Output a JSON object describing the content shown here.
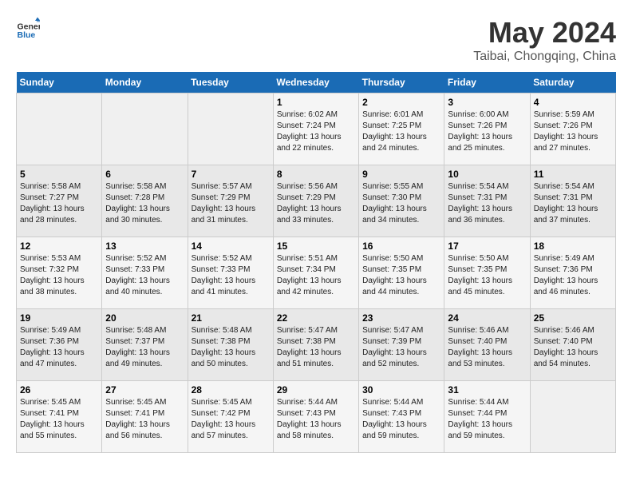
{
  "header": {
    "logo_general": "General",
    "logo_blue": "Blue",
    "title": "May 2024",
    "subtitle": "Taibai, Chongqing, China"
  },
  "days_of_week": [
    "Sunday",
    "Monday",
    "Tuesday",
    "Wednesday",
    "Thursday",
    "Friday",
    "Saturday"
  ],
  "weeks": [
    [
      {
        "day": "",
        "detail": ""
      },
      {
        "day": "",
        "detail": ""
      },
      {
        "day": "",
        "detail": ""
      },
      {
        "day": "1",
        "detail": "Sunrise: 6:02 AM\nSunset: 7:24 PM\nDaylight: 13 hours\nand 22 minutes."
      },
      {
        "day": "2",
        "detail": "Sunrise: 6:01 AM\nSunset: 7:25 PM\nDaylight: 13 hours\nand 24 minutes."
      },
      {
        "day": "3",
        "detail": "Sunrise: 6:00 AM\nSunset: 7:26 PM\nDaylight: 13 hours\nand 25 minutes."
      },
      {
        "day": "4",
        "detail": "Sunrise: 5:59 AM\nSunset: 7:26 PM\nDaylight: 13 hours\nand 27 minutes."
      }
    ],
    [
      {
        "day": "5",
        "detail": "Sunrise: 5:58 AM\nSunset: 7:27 PM\nDaylight: 13 hours\nand 28 minutes."
      },
      {
        "day": "6",
        "detail": "Sunrise: 5:58 AM\nSunset: 7:28 PM\nDaylight: 13 hours\nand 30 minutes."
      },
      {
        "day": "7",
        "detail": "Sunrise: 5:57 AM\nSunset: 7:29 PM\nDaylight: 13 hours\nand 31 minutes."
      },
      {
        "day": "8",
        "detail": "Sunrise: 5:56 AM\nSunset: 7:29 PM\nDaylight: 13 hours\nand 33 minutes."
      },
      {
        "day": "9",
        "detail": "Sunrise: 5:55 AM\nSunset: 7:30 PM\nDaylight: 13 hours\nand 34 minutes."
      },
      {
        "day": "10",
        "detail": "Sunrise: 5:54 AM\nSunset: 7:31 PM\nDaylight: 13 hours\nand 36 minutes."
      },
      {
        "day": "11",
        "detail": "Sunrise: 5:54 AM\nSunset: 7:31 PM\nDaylight: 13 hours\nand 37 minutes."
      }
    ],
    [
      {
        "day": "12",
        "detail": "Sunrise: 5:53 AM\nSunset: 7:32 PM\nDaylight: 13 hours\nand 38 minutes."
      },
      {
        "day": "13",
        "detail": "Sunrise: 5:52 AM\nSunset: 7:33 PM\nDaylight: 13 hours\nand 40 minutes."
      },
      {
        "day": "14",
        "detail": "Sunrise: 5:52 AM\nSunset: 7:33 PM\nDaylight: 13 hours\nand 41 minutes."
      },
      {
        "day": "15",
        "detail": "Sunrise: 5:51 AM\nSunset: 7:34 PM\nDaylight: 13 hours\nand 42 minutes."
      },
      {
        "day": "16",
        "detail": "Sunrise: 5:50 AM\nSunset: 7:35 PM\nDaylight: 13 hours\nand 44 minutes."
      },
      {
        "day": "17",
        "detail": "Sunrise: 5:50 AM\nSunset: 7:35 PM\nDaylight: 13 hours\nand 45 minutes."
      },
      {
        "day": "18",
        "detail": "Sunrise: 5:49 AM\nSunset: 7:36 PM\nDaylight: 13 hours\nand 46 minutes."
      }
    ],
    [
      {
        "day": "19",
        "detail": "Sunrise: 5:49 AM\nSunset: 7:36 PM\nDaylight: 13 hours\nand 47 minutes."
      },
      {
        "day": "20",
        "detail": "Sunrise: 5:48 AM\nSunset: 7:37 PM\nDaylight: 13 hours\nand 49 minutes."
      },
      {
        "day": "21",
        "detail": "Sunrise: 5:48 AM\nSunset: 7:38 PM\nDaylight: 13 hours\nand 50 minutes."
      },
      {
        "day": "22",
        "detail": "Sunrise: 5:47 AM\nSunset: 7:38 PM\nDaylight: 13 hours\nand 51 minutes."
      },
      {
        "day": "23",
        "detail": "Sunrise: 5:47 AM\nSunset: 7:39 PM\nDaylight: 13 hours\nand 52 minutes."
      },
      {
        "day": "24",
        "detail": "Sunrise: 5:46 AM\nSunset: 7:40 PM\nDaylight: 13 hours\nand 53 minutes."
      },
      {
        "day": "25",
        "detail": "Sunrise: 5:46 AM\nSunset: 7:40 PM\nDaylight: 13 hours\nand 54 minutes."
      }
    ],
    [
      {
        "day": "26",
        "detail": "Sunrise: 5:45 AM\nSunset: 7:41 PM\nDaylight: 13 hours\nand 55 minutes."
      },
      {
        "day": "27",
        "detail": "Sunrise: 5:45 AM\nSunset: 7:41 PM\nDaylight: 13 hours\nand 56 minutes."
      },
      {
        "day": "28",
        "detail": "Sunrise: 5:45 AM\nSunset: 7:42 PM\nDaylight: 13 hours\nand 57 minutes."
      },
      {
        "day": "29",
        "detail": "Sunrise: 5:44 AM\nSunset: 7:43 PM\nDaylight: 13 hours\nand 58 minutes."
      },
      {
        "day": "30",
        "detail": "Sunrise: 5:44 AM\nSunset: 7:43 PM\nDaylight: 13 hours\nand 59 minutes."
      },
      {
        "day": "31",
        "detail": "Sunrise: 5:44 AM\nSunset: 7:44 PM\nDaylight: 13 hours\nand 59 minutes."
      },
      {
        "day": "",
        "detail": ""
      }
    ]
  ]
}
